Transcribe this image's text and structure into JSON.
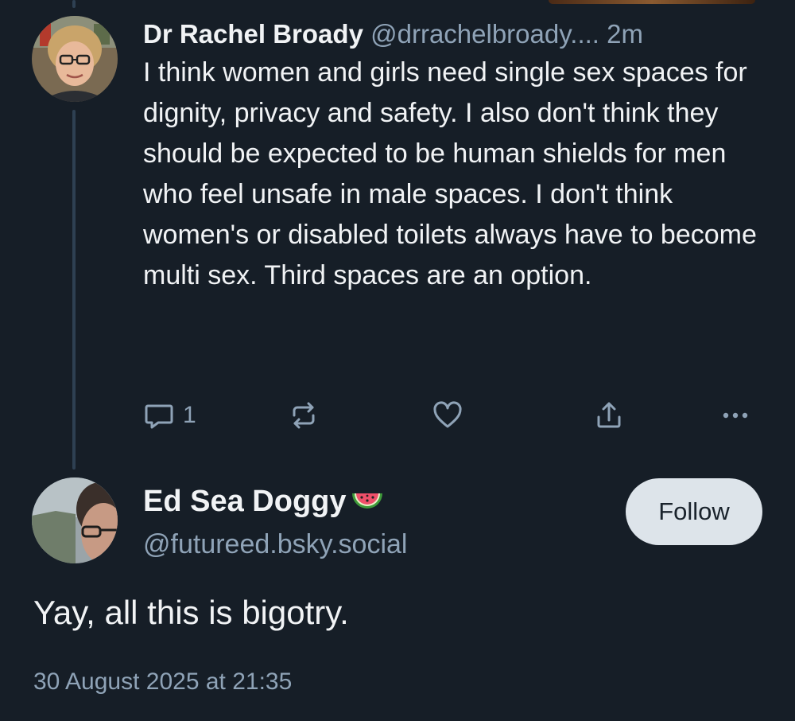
{
  "parent_post": {
    "author_name": "Dr Rachel Broady",
    "author_handle": "@drrachelbroady....",
    "time": "2m",
    "text": "I think women and girls need single sex spaces for dignity, privacy and safety. I also don't think they should be expected to be human shields for men who feel unsafe in male spaces. I don't think women's or disabled toilets always have to become multi sex. Third spaces are an option.",
    "reply_count": "1",
    "avatar_icon": "avatar-photo-woman-with-glasses"
  },
  "main_post": {
    "author_name": "Ed Sea Doggy",
    "author_emoji_icon": "watermelon-icon",
    "author_handle": "@futureed.bsky.social",
    "follow_label": "Follow",
    "text": "Yay, all this is bigotry.",
    "timestamp": "30 August 2025 at 21:35",
    "avatar_icon": "avatar-photo-man-with-glasses"
  },
  "colors": {
    "background": "#161e27",
    "primary_text": "#f1f3f5",
    "secondary_text": "#8fa3b7",
    "thread_line": "#2e4052",
    "follow_button_bg": "#dde4ea"
  }
}
